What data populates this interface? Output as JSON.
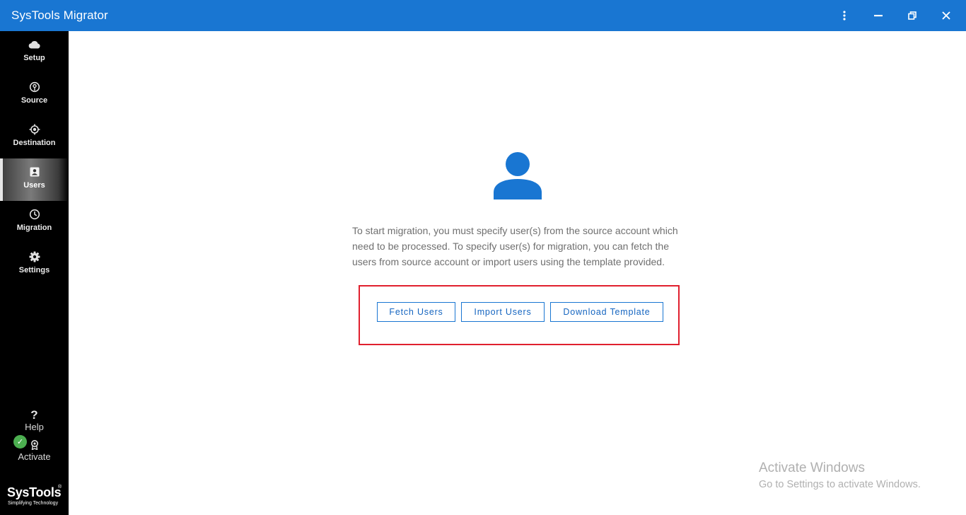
{
  "window": {
    "title": "SysTools Migrator",
    "controls": [
      "more-vert-icon",
      "minimize-icon",
      "restore-icon",
      "close-icon"
    ]
  },
  "sidebar": {
    "items": [
      {
        "label": "Setup",
        "icon": "cloud-icon"
      },
      {
        "label": "Source",
        "icon": "source-icon"
      },
      {
        "label": "Destination",
        "icon": "target-icon"
      },
      {
        "label": "Users",
        "icon": "user-card-icon",
        "active": true
      },
      {
        "label": "Migration",
        "icon": "clock-icon"
      },
      {
        "label": "Settings",
        "icon": "gear-icon"
      }
    ],
    "help": {
      "glyph": "?",
      "label": "Help"
    },
    "activate": {
      "label": "Activate",
      "status_icon": "check-icon",
      "status_color": "#4caf50"
    },
    "logo": {
      "brand": "SysTools",
      "registered": "®",
      "tagline": "Simplifying Technology"
    }
  },
  "main": {
    "illustration": "user-icon",
    "description": "To start migration, you must specify user(s) from the source account which need to be processed. To specify user(s) for migration, you can fetch the users from source account or import users using the template provided.",
    "buttons": {
      "fetch": "Fetch Users",
      "import": "Import Users",
      "download": "Download Template"
    }
  },
  "watermark": {
    "line1": "Activate Windows",
    "line2": "Go to Settings to activate Windows."
  },
  "colors": {
    "accent": "#1976d2",
    "sidebar": "#000000",
    "highlight": "#e0202e"
  }
}
